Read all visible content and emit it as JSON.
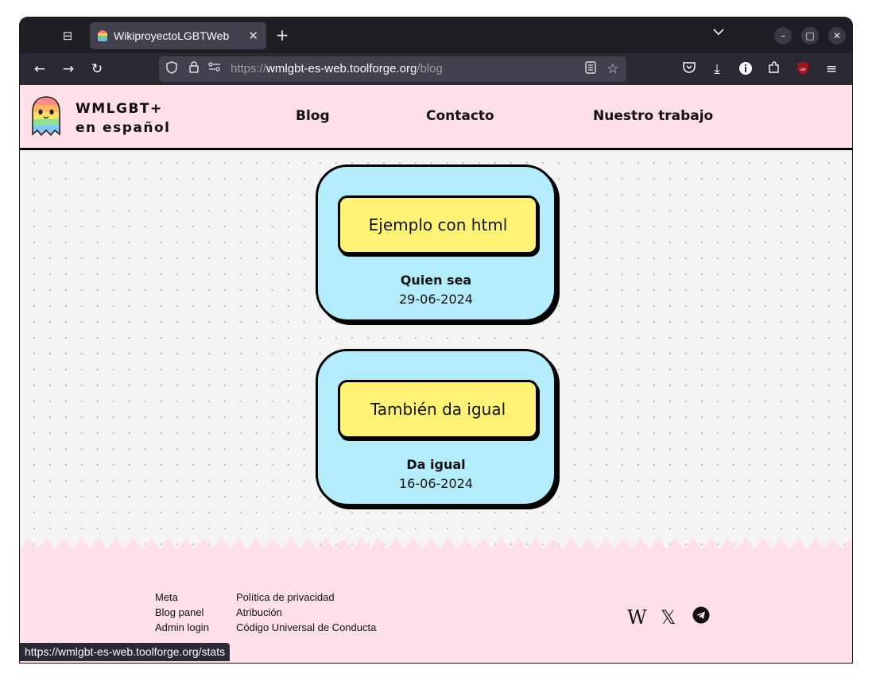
{
  "browser": {
    "tab_title": "WikiproyectoLGBTWeb",
    "tab_close": "✕",
    "new_tab": "+",
    "url_scheme": "https://",
    "url_host": "wmlgbt-es-web.toolforge.org",
    "url_path": "/blog",
    "status_url": "https://wmlgbt-es-web.toolforge.org/stats"
  },
  "site": {
    "brand_line1": "WMLGBT+",
    "brand_line2": "en español",
    "menu": [
      "Blog",
      "Contacto",
      "Nuestro trabajo"
    ]
  },
  "posts": [
    {
      "title": "Ejemplo con html",
      "author": "Quien sea",
      "date": "29-06-2024"
    },
    {
      "title": "También da igual",
      "author": "Da igual",
      "date": "16-06-2024"
    }
  ],
  "footer": {
    "col1": [
      "Meta",
      "Blog panel",
      "Admin login"
    ],
    "col2": [
      "Política de privacidad",
      "Atribución",
      "Código Universal de Conducta"
    ],
    "social_icons": [
      "wikipedia-icon",
      "x-icon",
      "telegram-icon"
    ],
    "social_glyphs": [
      "W",
      "𝕏"
    ]
  },
  "colors": {
    "header_bg": "#ffe0e8",
    "card_bg": "#b3ecfb",
    "title_bg": "#fff275"
  }
}
